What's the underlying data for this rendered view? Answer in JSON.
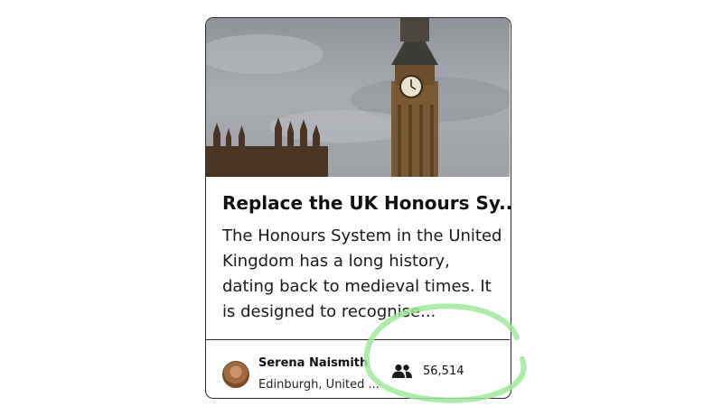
{
  "petition": {
    "title": "Replace the UK Honours Sy...",
    "description": "The Honours System in the United Kingdom has a long history, dating back to medieval times. It is designed to recognise...",
    "author": {
      "name": "Serena Naismith",
      "location": "Edinburgh, United ..."
    },
    "signature_count": "56,514"
  },
  "icons": {
    "signatures": "people-icon"
  },
  "colors": {
    "card_border": "#2b2b2b",
    "highlight_circle": "#9ee89a"
  }
}
